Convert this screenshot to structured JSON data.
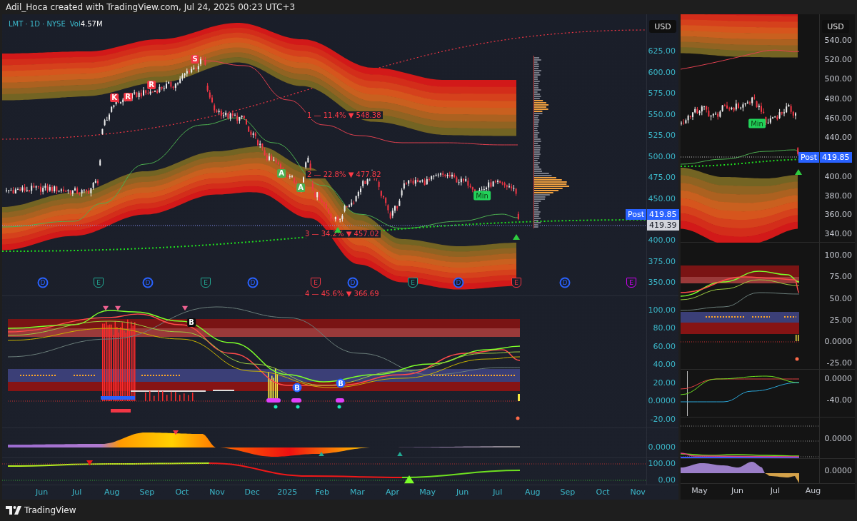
{
  "header": {
    "caption": "Adil_Hoca created with TradingView.com, Jul 24, 2025 00:23 UTC+3"
  },
  "main_chart": {
    "legend": {
      "symbol": "LMT · 1D · NYSE",
      "volume_label": "Vol",
      "volume_value": "4.57M"
    },
    "currency": "USD",
    "price_axis": [
      "625.00",
      "600.00",
      "575.00",
      "550.00",
      "525.00",
      "500.00",
      "475.00",
      "450.00",
      "400.00",
      "375.00",
      "350.00"
    ],
    "price_tags": [
      {
        "kind": "post",
        "label": "Post",
        "value": "419.85"
      },
      {
        "kind": "last",
        "value": "419.39"
      }
    ],
    "signals": [
      {
        "kind": "sell",
        "label": "K"
      },
      {
        "kind": "sell",
        "label": "R"
      },
      {
        "kind": "sell",
        "label": "R"
      },
      {
        "kind": "sell",
        "label": "S"
      },
      {
        "kind": "buy",
        "label": "A"
      },
      {
        "kind": "buy",
        "label": "A"
      },
      {
        "kind": "min",
        "label": "Min"
      }
    ],
    "fib_levels": [
      "1 — 11.4% ▼ 548.38",
      "2 — 22.8% ▼ 477.82",
      "3 — 34.2% ▼ 457.02",
      "4 — 45.6% ▼ 366.69"
    ],
    "events": [
      {
        "kind": "dividend",
        "label": "D",
        "color": "#2962ff"
      },
      {
        "kind": "earnings",
        "label": "E",
        "color": "#22ab94"
      },
      {
        "kind": "dividend",
        "label": "D",
        "color": "#2962ff"
      },
      {
        "kind": "earnings",
        "label": "E",
        "color": "#22ab94"
      },
      {
        "kind": "dividend",
        "label": "D",
        "color": "#2962ff"
      },
      {
        "kind": "earnings",
        "label": "E",
        "color": "#f23645"
      },
      {
        "kind": "dividend",
        "label": "D",
        "color": "#2962ff"
      },
      {
        "kind": "earnings",
        "label": "E",
        "color": "#22ab94"
      },
      {
        "kind": "dividend",
        "label": "D",
        "color": "#2962ff"
      },
      {
        "kind": "earnings",
        "label": "E",
        "color": "#f23645"
      },
      {
        "kind": "dividend",
        "label": "D",
        "color": "#2962ff"
      },
      {
        "kind": "earnings",
        "label": "E",
        "color": "#d500f9"
      }
    ],
    "indicator_panels": [
      {
        "kind": "oscillator",
        "axis": [
          "100.00",
          "80.00",
          "60.00",
          "40.00",
          "20.00",
          "0.0000",
          "-20.00"
        ],
        "signals": [
          {
            "kind": "box",
            "label": "B"
          },
          {
            "kind": "circle",
            "label": "B"
          },
          {
            "kind": "circle",
            "label": "B"
          }
        ]
      },
      {
        "kind": "area",
        "axis": [
          "0.0000"
        ]
      },
      {
        "kind": "line",
        "axis": [
          "100.00",
          "0.00"
        ]
      }
    ],
    "time_axis": [
      "Jun",
      "Jul",
      "Aug",
      "Sep",
      "Oct",
      "Nov",
      "Dec",
      "2025",
      "Feb",
      "Mar",
      "Apr",
      "May",
      "Jun",
      "Jul",
      "Aug",
      "Sep",
      "Oct",
      "Nov"
    ]
  },
  "side_chart": {
    "currency": "USD",
    "price_axis": [
      "540.00",
      "520.00",
      "500.00",
      "480.00",
      "460.00",
      "440.00",
      "400.00",
      "380.00",
      "360.00",
      "340.00"
    ],
    "price_tags": [
      {
        "kind": "post",
        "label": "Post",
        "value": "419.85"
      }
    ],
    "signals": [
      {
        "kind": "min",
        "label": "Min"
      }
    ],
    "indicator_panels": [
      {
        "kind": "oscillator",
        "axis": [
          "100.00",
          "75.00",
          "50.00",
          "25.00",
          "0.0000",
          "-25.00"
        ]
      },
      {
        "kind": "crossover",
        "axis": [
          "0.0000",
          "-40.00"
        ]
      },
      {
        "kind": "histogram",
        "axis": [
          "0.0000"
        ]
      },
      {
        "kind": "area",
        "axis": [
          "0.0000"
        ]
      }
    ],
    "time_axis": [
      "May",
      "Jun",
      "Jul",
      "Aug"
    ]
  },
  "footer": {
    "brand": "TradingView"
  }
}
